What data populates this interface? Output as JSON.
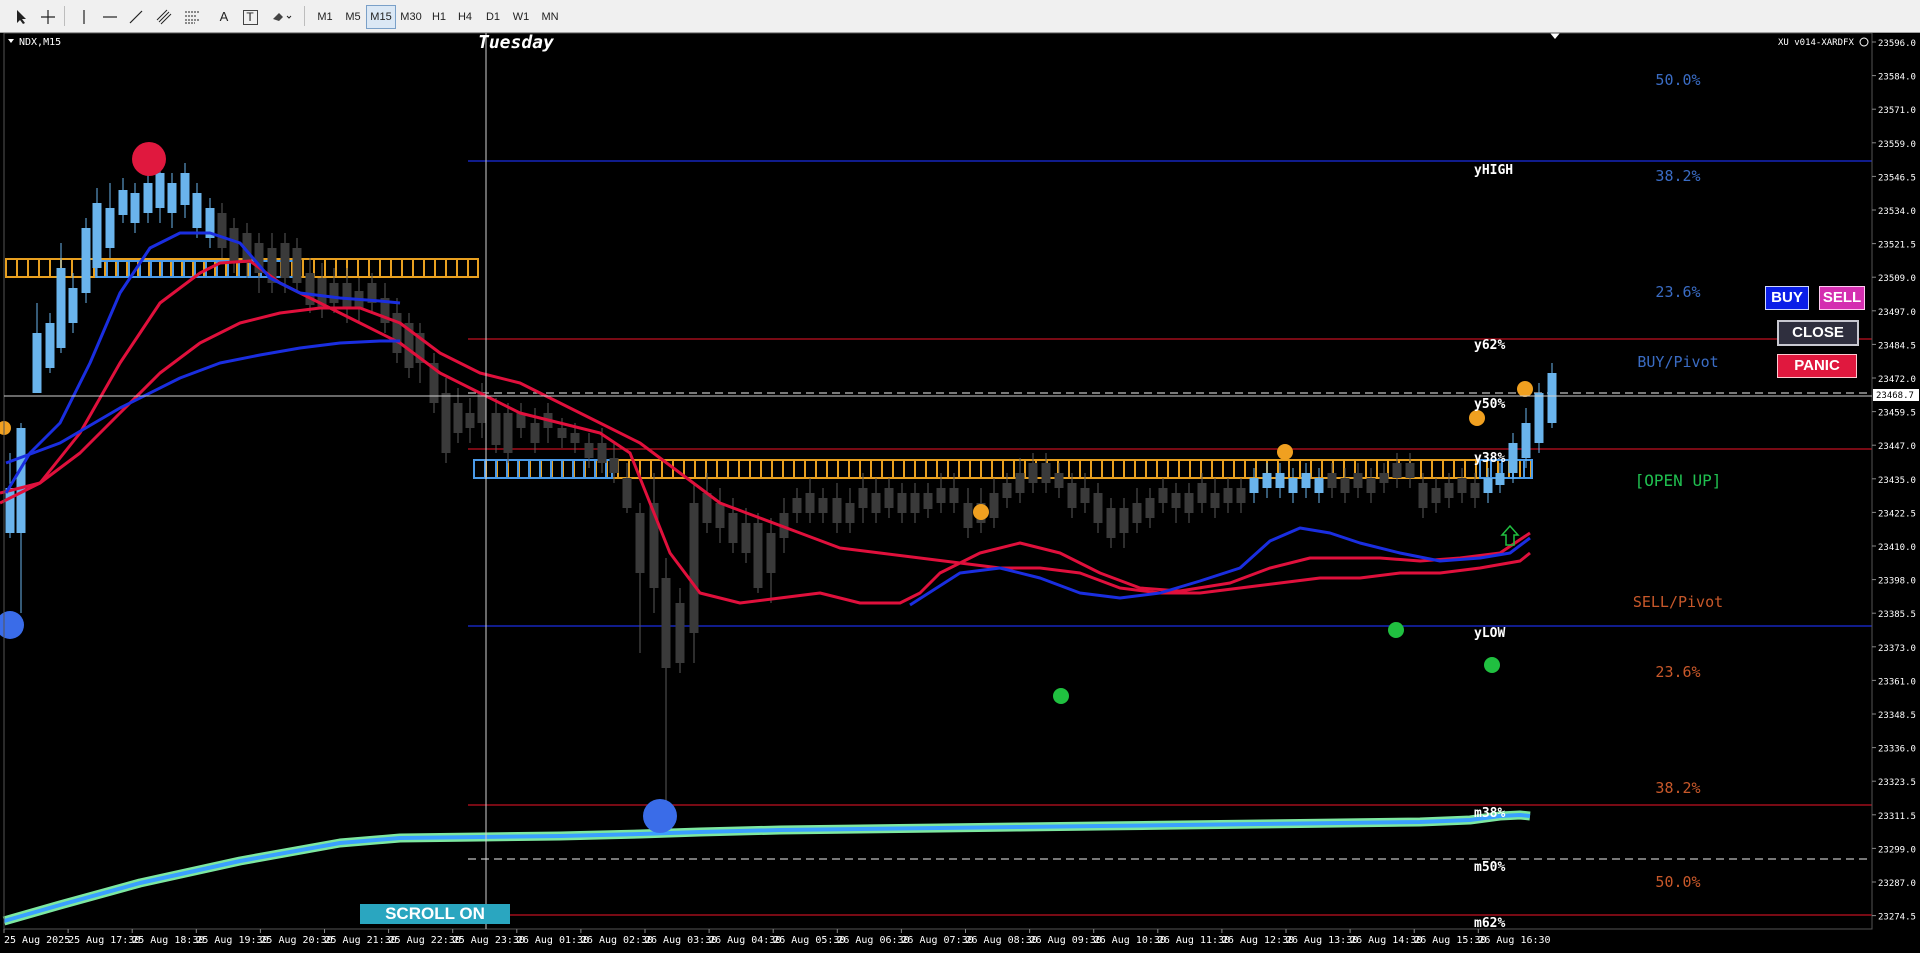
{
  "toolbar": {
    "timeframes": [
      "M1",
      "M5",
      "M15",
      "M30",
      "H1",
      "H4",
      "D1",
      "W1",
      "MN"
    ],
    "active_timeframe": "M15",
    "tools": [
      "cursor-icon",
      "crosshair-icon",
      "vertical-line-icon",
      "horizontal-line-icon",
      "trendline-icon",
      "channel-icon",
      "fibonacci-icon",
      "text-icon",
      "text-label-icon",
      "shapes-icon"
    ],
    "text_tool_label": "A",
    "text_label_tool_label": "T"
  },
  "chart": {
    "symbol": "NDX,M15",
    "day_label": "Tuesday",
    "indicator_label": "XU v014-XARDFX",
    "current_price": "23468.7",
    "price_ticks": [
      "23596.0",
      "23584.0",
      "23571.0",
      "23559.0",
      "23546.5",
      "23534.0",
      "23521.5",
      "23509.0",
      "23497.0",
      "23484.5",
      "23472.0",
      "23459.5",
      "23447.0",
      "23435.0",
      "23422.5",
      "23410.0",
      "23398.0",
      "23385.5",
      "23373.0",
      "23361.0",
      "23348.5",
      "23336.0",
      "23323.5",
      "23311.5",
      "23299.0",
      "23287.0",
      "23274.5"
    ],
    "time_ticks": [
      "25 Aug 2025",
      "25 Aug 17:30",
      "25 Aug 18:30",
      "25 Aug 19:30",
      "25 Aug 20:30",
      "25 Aug 21:30",
      "25 Aug 22:30",
      "25 Aug 23:30",
      "26 Aug 01:30",
      "26 Aug 02:30",
      "26 Aug 03:30",
      "26 Aug 04:30",
      "26 Aug 05:30",
      "26 Aug 06:30",
      "26 Aug 07:30",
      "26 Aug 08:30",
      "26 Aug 09:30",
      "26 Aug 10:30",
      "26 Aug 11:30",
      "26 Aug 12:30",
      "26 Aug 13:30",
      "26 Aug 14:30",
      "26 Aug 15:30",
      "26 Aug 16:30"
    ],
    "level_labels": {
      "yhigh": "yHIGH",
      "y62": "y62%",
      "y50": "y50%",
      "y38": "y38%",
      "ylow": "yLOW",
      "m38": "m38%",
      "m50": "m50%",
      "m62": "m62%"
    },
    "fib_upper": [
      "50.0%",
      "38.2%",
      "23.6%"
    ],
    "buy_pivot": "BUY/Pivot",
    "open_status": "[OPEN UP]",
    "sell_pivot": "SELL/Pivot",
    "fib_lower": [
      "23.6%",
      "38.2%",
      "50.0%"
    ],
    "colors": {
      "bull": "#6ab4ec",
      "bear": "#3a3a3a",
      "fast_ma": "#e0103c",
      "slow_ma": "#1a2ee0",
      "long_ma": "#3aa0ff",
      "long_ma_glow": "#7de8a0",
      "zone_gold": "#e8a020",
      "zone_blue": "#4a9ae8",
      "fib_upper": "#3a6cc4",
      "fib_lower": "#c8582a",
      "open_up": "#20c050"
    }
  },
  "buttons": {
    "buy": "BUY",
    "sell": "SELL",
    "close": "CLOSE",
    "panic": "PANIC",
    "scroll": "SCROLL ON"
  }
}
